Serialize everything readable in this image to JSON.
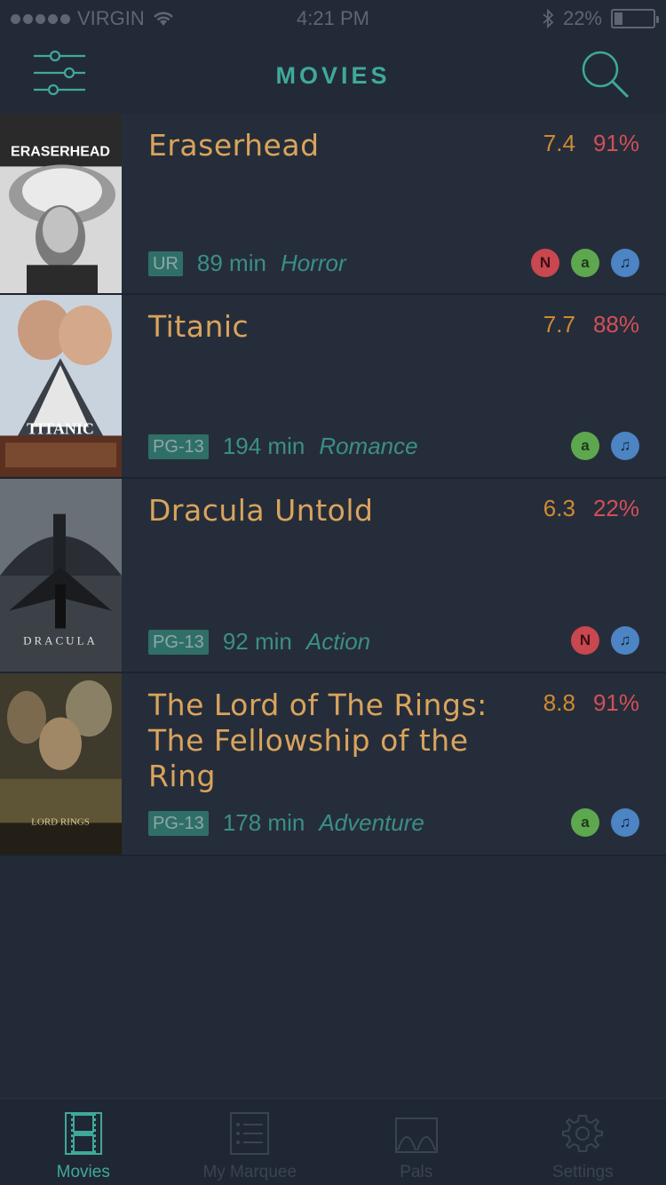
{
  "status_bar": {
    "carrier": "VIRGIN",
    "time": "4:21 PM",
    "battery": "22%",
    "battery_level": 0.22
  },
  "header": {
    "title": "MOVIES",
    "filter_icon": "sliders-icon",
    "search_icon": "search-icon"
  },
  "colors": {
    "background": "#232a37",
    "accent": "#3ea99a",
    "title": "#d9a45c",
    "imdb": "#cf8a32",
    "rt": "#d24f57"
  },
  "movies": [
    {
      "title": "Eraserhead",
      "imdb_score": "7.4",
      "rt_score": "91%",
      "rating": "UR",
      "runtime": "89 min",
      "genre": "Horror",
      "providers": [
        "netflix",
        "amazon",
        "itunes"
      ],
      "poster_text": "ERASERHEAD"
    },
    {
      "title": "Titanic",
      "imdb_score": "7.7",
      "rt_score": "88%",
      "rating": "PG-13",
      "runtime": "194 min",
      "genre": "Romance",
      "providers": [
        "amazon",
        "itunes"
      ],
      "poster_text": "TITANIC"
    },
    {
      "title": "Dracula Untold",
      "imdb_score": "6.3",
      "rt_score": "22%",
      "rating": "PG-13",
      "runtime": "92 min",
      "genre": "Action",
      "providers": [
        "netflix",
        "itunes"
      ],
      "poster_text": "DRACULA"
    },
    {
      "title": "The Lord of The Rings: The Fellowship of the Ring",
      "imdb_score": "8.8",
      "rt_score": "91%",
      "rating": "PG-13",
      "runtime": "178 min",
      "genre": "Adventure",
      "providers": [
        "amazon",
        "itunes"
      ],
      "poster_text": "LORD RINGS"
    }
  ],
  "tabs": [
    {
      "label": "Movies",
      "icon": "film-icon",
      "active": true
    },
    {
      "label": "My Marquee",
      "icon": "list-icon",
      "active": false
    },
    {
      "label": "Pals",
      "icon": "pals-icon",
      "active": false
    },
    {
      "label": "Settings",
      "icon": "gear-icon",
      "active": false
    }
  ]
}
